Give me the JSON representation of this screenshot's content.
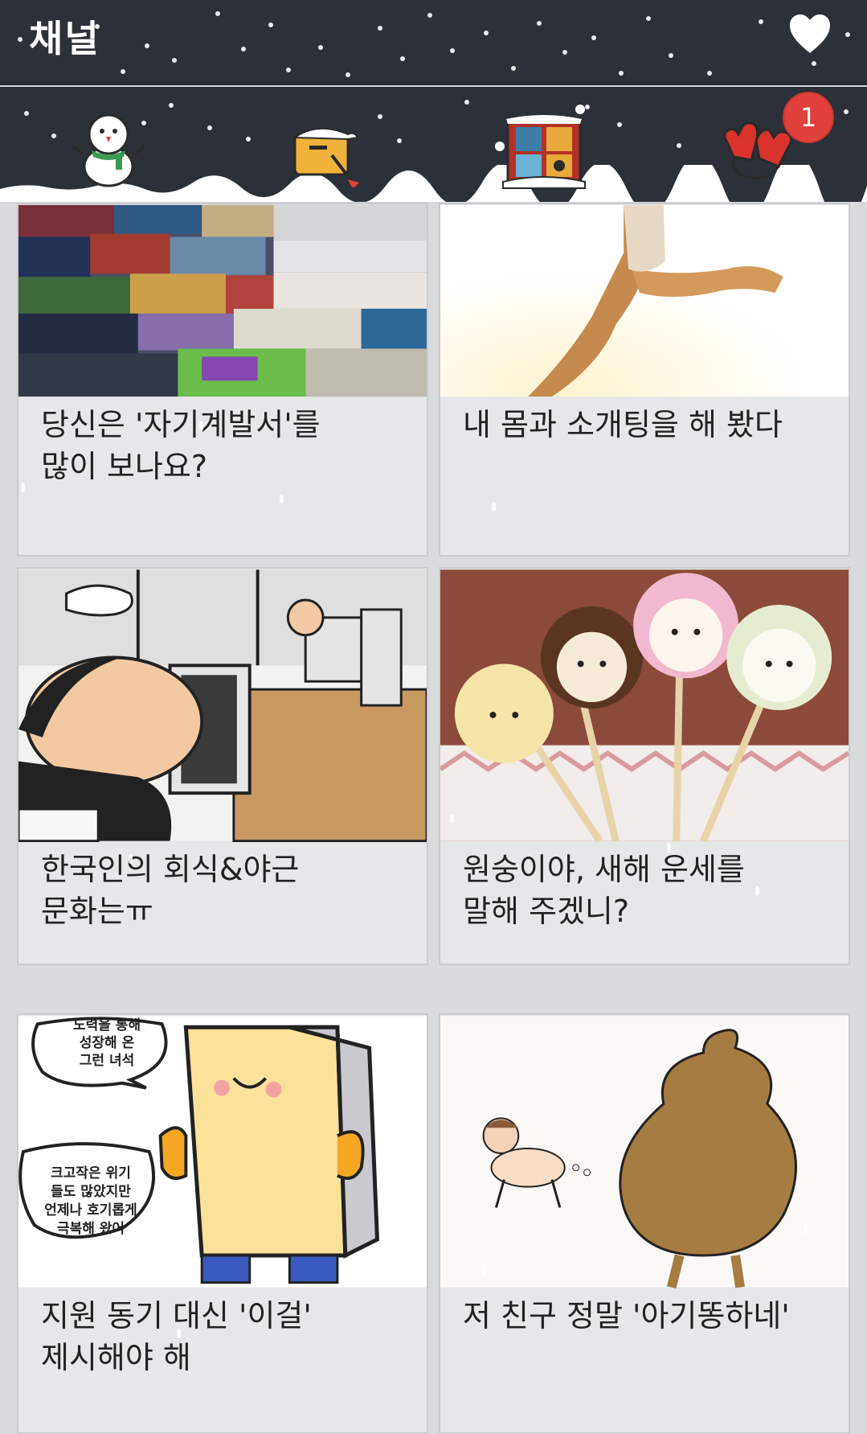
{
  "header": {
    "title": "채널",
    "heart_icon": "heart-icon"
  },
  "tabs": [
    {
      "icon": "snowman-icon"
    },
    {
      "icon": "mailbox-icon"
    },
    {
      "icon": "window-icon"
    },
    {
      "icon": "mittens-icon",
      "badge": "1"
    }
  ],
  "colors": {
    "header_bg": "#2c3038",
    "badge": "#e0413b",
    "card_bg": "#e6e7e9",
    "page_bg": "#d9dadc"
  },
  "cards": [
    {
      "image": "books-stack-image",
      "caption": "당신은 '자기계발서'를\n많이 보나요?"
    },
    {
      "image": "running-legs-sunlight-image",
      "caption": "내 몸과 소개팅을 해 봤다"
    },
    {
      "image": "office-worker-cartoon-image",
      "caption": "한국인의 회식&야근\n문화는ㅠ"
    },
    {
      "image": "animal-cake-pops-image",
      "caption": "원숭이야, 새해 운세를\n말해 주겠니?"
    },
    {
      "image": "building-character-cartoon-image",
      "caption": "지원 동기 대신 '이걸'\n제시해야 해",
      "bubble_top": "노력을 통해\n성장해 온\n그런 녀석",
      "bubble_left": "크고작은 위기\n들도 많았지만\n언제나 호기롭게\n극복해 왔어"
    },
    {
      "image": "baby-and-poop-cartoon-image",
      "caption": "저 친구 정말 '아기똥하네'"
    }
  ]
}
